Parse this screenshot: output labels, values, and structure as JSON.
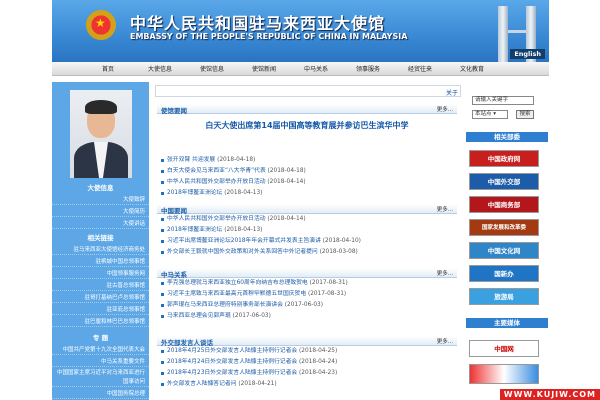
{
  "header": {
    "title_cn": "中华人民共和国驻马来西亚大使馆",
    "title_en": "EMBASSY OF THE PEOPLE'S REPUBLIC OF CHINA IN MALAYSIA",
    "english_link": "English"
  },
  "nav": [
    "首页",
    "大使信息",
    "使馆信息",
    "使馆新闻",
    "中马关系",
    "领事服务",
    "经贸往来",
    "文化教育"
  ],
  "ticker": "关于",
  "left": {
    "ambassador_head": "大使信息",
    "ambassador_items": [
      "大使致辞",
      "大使简历",
      "大使讲话"
    ],
    "links_head": "相关链接",
    "links_items": [
      "驻马来西亚大使馆经济商务处",
      "驻槟城中国总领事馆",
      "中国领事服务网",
      "驻古晋总领事馆",
      "驻哥打基纳巴卢总领事馆",
      "驻亚庇总领事馆",
      "驻巴厘和林巴巴总领事馆"
    ],
    "topics_head": "专 题",
    "topics_items": [
      "中国共产党第十九次全国代表大会",
      "中马关系重要文件",
      "中国国家主席习近平对马来西亚进行国事访问",
      "中国国务院总理"
    ]
  },
  "sections": [
    {
      "title": "使馆要闻",
      "more": "更多...",
      "feature": "白天大使出席第14届中国高等教育展并参访巴生滨华中学",
      "items": [
        {
          "text": "张开双臂 共迎发展",
          "date": "(2018-04-18)"
        },
        {
          "text": "白天大使会见马来西亚“八大华青”代表",
          "date": "(2018-04-18)"
        },
        {
          "text": "中华人民共和国外交部举办开放日活动",
          "date": "(2018-04-14)"
        },
        {
          "text": "2018年博鳌亚洲论坛",
          "date": "(2018-04-13)"
        }
      ]
    },
    {
      "title": "中国要闻",
      "more": "更多...",
      "items": [
        {
          "text": "中华人民共和国外交部举办开放日活动",
          "date": "(2018-04-14)"
        },
        {
          "text": "2018年博鳌亚洲论坛",
          "date": "(2018-04-13)"
        },
        {
          "text": "习近平出席博鳌亚洲论坛2018年年会开幕式并发表主旨演讲",
          "date": "(2018-04-10)"
        },
        {
          "text": "外交部长王毅就中国外交政策和对外关系回答中外记者提问",
          "date": "(2018-03-08)"
        }
      ]
    },
    {
      "title": "中马关系",
      "more": "更多...",
      "items": [
        {
          "text": "李克强总理就马来西亚独立60周年向纳吉布总理致贺电",
          "date": "(2017-08-31)"
        },
        {
          "text": "习近平主席致马来西亚最高元首穆罕默德五世国庆贺电",
          "date": "(2017-08-31)"
        },
        {
          "text": "郭声琨在马来西亚总理府特别事务部长演讲会",
          "date": "(2017-06-03)"
        },
        {
          "text": "马来西亚总理会见郭声琨",
          "date": "(2017-06-03)"
        }
      ]
    },
    {
      "title": "外交部发言人谈话",
      "more": "更多...",
      "items": [
        {
          "text": "2018年4月25日外交部发言人陆慷主持例行记者会",
          "date": "(2018-04-25)"
        },
        {
          "text": "2018年4月24日外交部发言人陆慷主持例行记者会",
          "date": "(2018-04-24)"
        },
        {
          "text": "2018年4月23日外交部发言人陆慷主持例行记者会",
          "date": "(2018-04-23)"
        },
        {
          "text": "外交部发言人陆慷答记者问",
          "date": "(2018-04-21)"
        }
      ]
    }
  ],
  "right": {
    "search_placeholder": "请输入关键字",
    "scope": "本站点",
    "search_button": "搜索",
    "dept_head": "相关部委",
    "logos": [
      "中国政府网",
      "中国外交部",
      "中国商务部",
      "国家发展和改革委",
      "中国文化网",
      "国新办",
      "旅游局"
    ],
    "media_head": "主要媒体",
    "media_logo": "中国网"
  },
  "watermark": "WWW.KUJIW.COM",
  "colors": {
    "header_blue": "#3b8bd6",
    "left_blue": "#5ea7e6",
    "link_blue": "#1a5aa6",
    "accent_red": "#d22"
  }
}
